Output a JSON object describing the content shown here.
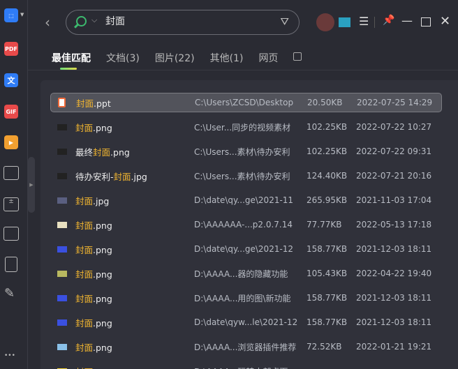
{
  "sidebar": {
    "items": [
      "crop-tool",
      "pdf-tool",
      "ocr-tool",
      "gif-tool",
      "video-tool",
      "monitor",
      "calculator",
      "monitor-stats",
      "notes",
      "pen"
    ],
    "pdf": "PDF",
    "ocr": "文",
    "gif": "GIF",
    "more": "•••"
  },
  "search": {
    "query": "封面",
    "placeholder": ""
  },
  "tabs": [
    {
      "label": "最佳匹配"
    },
    {
      "label": "文档(3)"
    },
    {
      "label": "图片(22)"
    },
    {
      "label": "其他(1)"
    },
    {
      "label": "网页"
    }
  ],
  "results": [
    {
      "pre": "",
      "hl": "封面",
      "post": ".ppt",
      "path": "C:\\Users\\ZCSD\\Desktop",
      "size": "20.50KB",
      "date": "2022-07-25 14:29",
      "icon": "ppt",
      "color": "#f06a3a"
    },
    {
      "pre": "",
      "hl": "封面",
      "post": ".png",
      "path": "C:\\User...同步的视频素材",
      "size": "102.25KB",
      "date": "2022-07-22 10:27",
      "icon": "image",
      "color": "#222"
    },
    {
      "pre": "最终",
      "hl": "封面",
      "post": ".png",
      "path": "C:\\Users...素材\\待办安利",
      "size": "102.25KB",
      "date": "2022-07-22 09:31",
      "icon": "image",
      "color": "#222"
    },
    {
      "pre": "待办安利-",
      "hl": "封面",
      "post": ".jpg",
      "path": "C:\\Users...素材\\待办安利",
      "size": "124.40KB",
      "date": "2022-07-21 20:16",
      "icon": "image",
      "color": "#222"
    },
    {
      "pre": "",
      "hl": "封面",
      "post": ".jpg",
      "path": "D:\\date\\qy...ge\\2021-11",
      "size": "265.95KB",
      "date": "2021-11-03 17:04",
      "icon": "image",
      "color": "#5a5f80"
    },
    {
      "pre": "",
      "hl": "封面",
      "post": ".png",
      "path": "D:\\AAAAAA-...p2.0.7.14",
      "size": "77.77KB",
      "date": "2022-05-13 17:18",
      "icon": "image",
      "color": "#e8e0c0"
    },
    {
      "pre": "",
      "hl": "封面",
      "post": ".png",
      "path": "D:\\date\\qy...ge\\2021-12",
      "size": "158.77KB",
      "date": "2021-12-03 18:11",
      "icon": "image",
      "color": "#3a50e0"
    },
    {
      "pre": "",
      "hl": "封面",
      "post": ".png",
      "path": "D:\\AAAA...器的隐藏功能",
      "size": "105.43KB",
      "date": "2022-04-22 19:40",
      "icon": "image",
      "color": "#b8b860"
    },
    {
      "pre": "",
      "hl": "封面",
      "post": ".png",
      "path": "D:\\AAAA...用的图\\新功能",
      "size": "158.77KB",
      "date": "2021-12-03 18:11",
      "icon": "image",
      "color": "#3a50e0"
    },
    {
      "pre": "",
      "hl": "封面",
      "post": ".png",
      "path": "D:\\date\\qyw...le\\2021-12",
      "size": "158.77KB",
      "date": "2021-12-03 18:11",
      "icon": "image",
      "color": "#3a50e0"
    },
    {
      "pre": "",
      "hl": "封面",
      "post": ".png",
      "path": "D:\\AAAA...浏览器插件推荐",
      "size": "72.52KB",
      "date": "2022-01-21 19:21",
      "icon": "image",
      "color": "#8ac0e8"
    },
    {
      "pre": "",
      "hl": "封面",
      "post": "",
      "path": "D:\\AAAA...玩转小部桌面",
      "size": "",
      "date": "",
      "icon": "image",
      "color": "#f2d030"
    }
  ]
}
